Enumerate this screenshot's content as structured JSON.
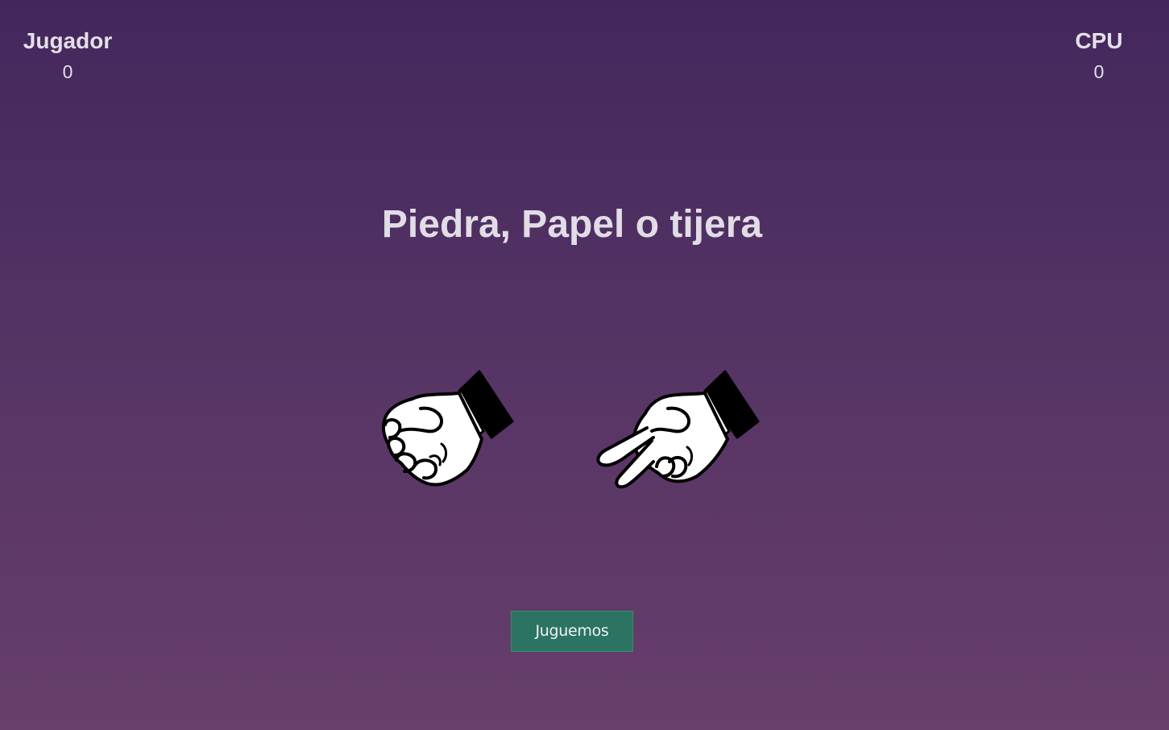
{
  "scoreboard": {
    "player": {
      "label": "Jugador",
      "score": "0"
    },
    "cpu": {
      "label": "CPU",
      "score": "0"
    }
  },
  "title": "Piedra, Papel o tijera",
  "hands": {
    "player": {
      "choice": "rock",
      "icon": "rock-hand-icon"
    },
    "cpu": {
      "choice": "scissors",
      "icon": "scissors-hand-icon"
    }
  },
  "play_button": {
    "label": "Juguemos"
  },
  "colors": {
    "background_top": "#43275c",
    "background_bottom": "#673f6b",
    "button": "#2c7462",
    "text": "#e4dfe8"
  }
}
